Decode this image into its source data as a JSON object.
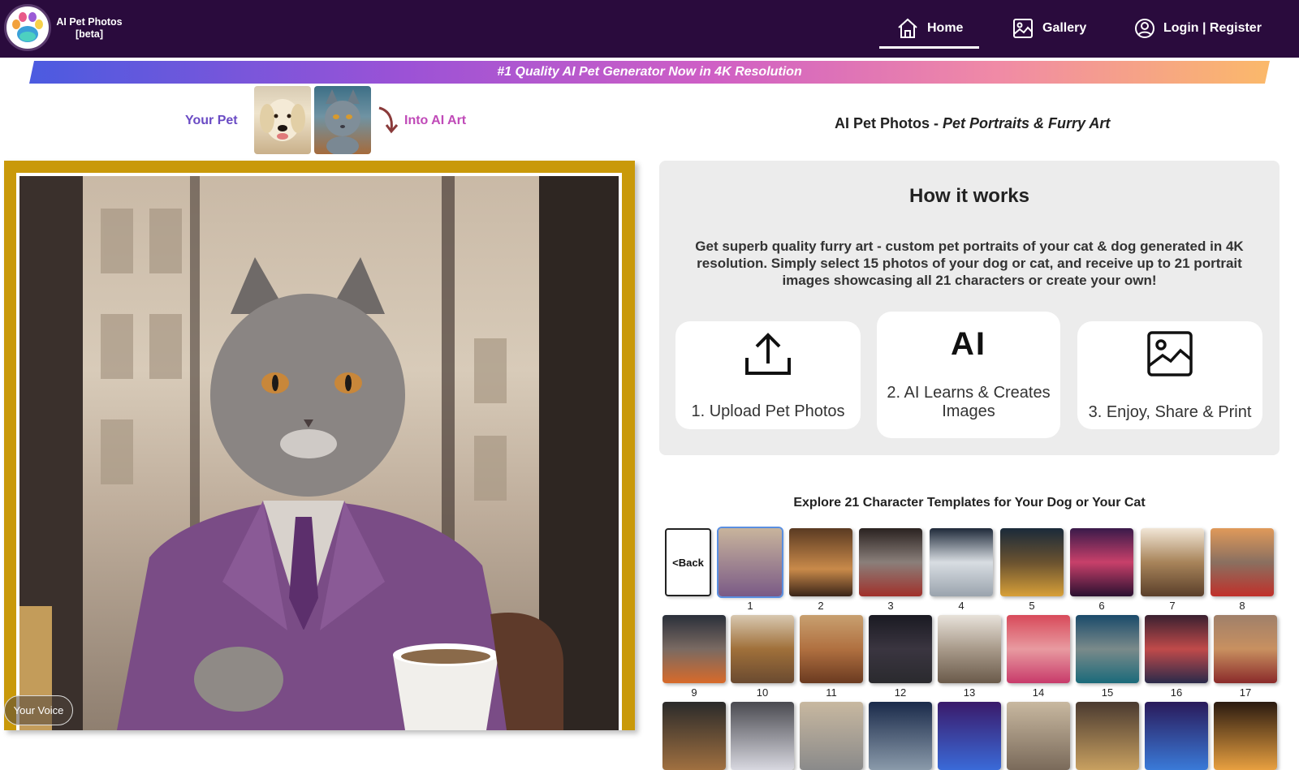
{
  "header": {
    "brand_line1": "AI Pet Photos",
    "brand_line2": "[beta]",
    "nav": {
      "home": "Home",
      "gallery": "Gallery",
      "login": "Login | Register"
    }
  },
  "banner": {
    "text": "#1 Quality AI Pet Generator Now in 4K Resolution"
  },
  "transform": {
    "left_label": "Your Pet",
    "right_label": "Into AI Art"
  },
  "subtitle": {
    "prefix": "AI Pet Photos - ",
    "emphasis": "Pet Portraits & Furry Art"
  },
  "how_it_works": {
    "title": "How it works",
    "description": "Get superb quality furry art - custom pet portraits of your cat & dog generated in 4K resolution. Simply select 15 photos of your dog or cat, and receive up to 21 portrait images showcasing all 21 characters or create your own!",
    "steps": [
      {
        "icon": "upload-icon",
        "label": "1. Upload Pet Photos"
      },
      {
        "icon": "ai-icon",
        "icon_text": "AI",
        "label": "2. AI Learns & Creates Images"
      },
      {
        "icon": "image-icon",
        "label": "3. Enjoy, Share & Print"
      }
    ]
  },
  "templates": {
    "title": "Explore 21 Character Templates for Your Dog or Your Cat",
    "back_label_1": "<",
    "back_label_2": "Back",
    "selected": "1",
    "row1": [
      "1",
      "2",
      "3",
      "4",
      "5",
      "6",
      "7",
      "8"
    ],
    "row2": [
      "9",
      "10",
      "11",
      "12",
      "13",
      "14",
      "15",
      "16",
      "17"
    ]
  },
  "voice_button": "Your Voice",
  "colors": {
    "header_bg": "#2a0b3d",
    "frame_gold": "#c9990a",
    "your_pet": "#6a4bc4",
    "into_art": "#c04ab8"
  }
}
